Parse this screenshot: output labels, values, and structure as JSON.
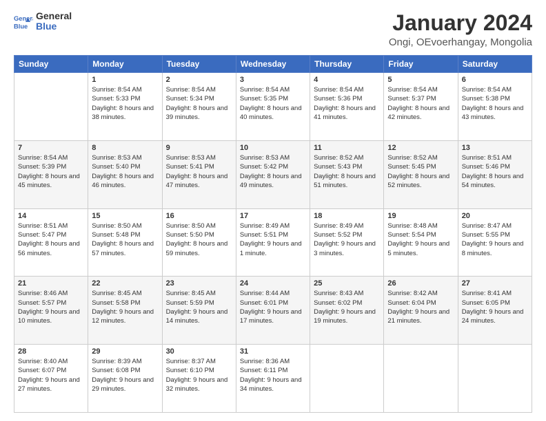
{
  "logo": {
    "text_general": "General",
    "text_blue": "Blue"
  },
  "header": {
    "title": "January 2024",
    "subtitle": "Ongi, OEvoerhangay, Mongolia"
  },
  "weekdays": [
    "Sunday",
    "Monday",
    "Tuesday",
    "Wednesday",
    "Thursday",
    "Friday",
    "Saturday"
  ],
  "weeks": [
    [
      {
        "day": "",
        "sunrise": "",
        "sunset": "",
        "daylight": ""
      },
      {
        "day": "1",
        "sunrise": "Sunrise: 8:54 AM",
        "sunset": "Sunset: 5:33 PM",
        "daylight": "Daylight: 8 hours and 38 minutes."
      },
      {
        "day": "2",
        "sunrise": "Sunrise: 8:54 AM",
        "sunset": "Sunset: 5:34 PM",
        "daylight": "Daylight: 8 hours and 39 minutes."
      },
      {
        "day": "3",
        "sunrise": "Sunrise: 8:54 AM",
        "sunset": "Sunset: 5:35 PM",
        "daylight": "Daylight: 8 hours and 40 minutes."
      },
      {
        "day": "4",
        "sunrise": "Sunrise: 8:54 AM",
        "sunset": "Sunset: 5:36 PM",
        "daylight": "Daylight: 8 hours and 41 minutes."
      },
      {
        "day": "5",
        "sunrise": "Sunrise: 8:54 AM",
        "sunset": "Sunset: 5:37 PM",
        "daylight": "Daylight: 8 hours and 42 minutes."
      },
      {
        "day": "6",
        "sunrise": "Sunrise: 8:54 AM",
        "sunset": "Sunset: 5:38 PM",
        "daylight": "Daylight: 8 hours and 43 minutes."
      }
    ],
    [
      {
        "day": "7",
        "sunrise": "Sunrise: 8:54 AM",
        "sunset": "Sunset: 5:39 PM",
        "daylight": "Daylight: 8 hours and 45 minutes."
      },
      {
        "day": "8",
        "sunrise": "Sunrise: 8:53 AM",
        "sunset": "Sunset: 5:40 PM",
        "daylight": "Daylight: 8 hours and 46 minutes."
      },
      {
        "day": "9",
        "sunrise": "Sunrise: 8:53 AM",
        "sunset": "Sunset: 5:41 PM",
        "daylight": "Daylight: 8 hours and 47 minutes."
      },
      {
        "day": "10",
        "sunrise": "Sunrise: 8:53 AM",
        "sunset": "Sunset: 5:42 PM",
        "daylight": "Daylight: 8 hours and 49 minutes."
      },
      {
        "day": "11",
        "sunrise": "Sunrise: 8:52 AM",
        "sunset": "Sunset: 5:43 PM",
        "daylight": "Daylight: 8 hours and 51 minutes."
      },
      {
        "day": "12",
        "sunrise": "Sunrise: 8:52 AM",
        "sunset": "Sunset: 5:45 PM",
        "daylight": "Daylight: 8 hours and 52 minutes."
      },
      {
        "day": "13",
        "sunrise": "Sunrise: 8:51 AM",
        "sunset": "Sunset: 5:46 PM",
        "daylight": "Daylight: 8 hours and 54 minutes."
      }
    ],
    [
      {
        "day": "14",
        "sunrise": "Sunrise: 8:51 AM",
        "sunset": "Sunset: 5:47 PM",
        "daylight": "Daylight: 8 hours and 56 minutes."
      },
      {
        "day": "15",
        "sunrise": "Sunrise: 8:50 AM",
        "sunset": "Sunset: 5:48 PM",
        "daylight": "Daylight: 8 hours and 57 minutes."
      },
      {
        "day": "16",
        "sunrise": "Sunrise: 8:50 AM",
        "sunset": "Sunset: 5:50 PM",
        "daylight": "Daylight: 8 hours and 59 minutes."
      },
      {
        "day": "17",
        "sunrise": "Sunrise: 8:49 AM",
        "sunset": "Sunset: 5:51 PM",
        "daylight": "Daylight: 9 hours and 1 minute."
      },
      {
        "day": "18",
        "sunrise": "Sunrise: 8:49 AM",
        "sunset": "Sunset: 5:52 PM",
        "daylight": "Daylight: 9 hours and 3 minutes."
      },
      {
        "day": "19",
        "sunrise": "Sunrise: 8:48 AM",
        "sunset": "Sunset: 5:54 PM",
        "daylight": "Daylight: 9 hours and 5 minutes."
      },
      {
        "day": "20",
        "sunrise": "Sunrise: 8:47 AM",
        "sunset": "Sunset: 5:55 PM",
        "daylight": "Daylight: 9 hours and 8 minutes."
      }
    ],
    [
      {
        "day": "21",
        "sunrise": "Sunrise: 8:46 AM",
        "sunset": "Sunset: 5:57 PM",
        "daylight": "Daylight: 9 hours and 10 minutes."
      },
      {
        "day": "22",
        "sunrise": "Sunrise: 8:45 AM",
        "sunset": "Sunset: 5:58 PM",
        "daylight": "Daylight: 9 hours and 12 minutes."
      },
      {
        "day": "23",
        "sunrise": "Sunrise: 8:45 AM",
        "sunset": "Sunset: 5:59 PM",
        "daylight": "Daylight: 9 hours and 14 minutes."
      },
      {
        "day": "24",
        "sunrise": "Sunrise: 8:44 AM",
        "sunset": "Sunset: 6:01 PM",
        "daylight": "Daylight: 9 hours and 17 minutes."
      },
      {
        "day": "25",
        "sunrise": "Sunrise: 8:43 AM",
        "sunset": "Sunset: 6:02 PM",
        "daylight": "Daylight: 9 hours and 19 minutes."
      },
      {
        "day": "26",
        "sunrise": "Sunrise: 8:42 AM",
        "sunset": "Sunset: 6:04 PM",
        "daylight": "Daylight: 9 hours and 21 minutes."
      },
      {
        "day": "27",
        "sunrise": "Sunrise: 8:41 AM",
        "sunset": "Sunset: 6:05 PM",
        "daylight": "Daylight: 9 hours and 24 minutes."
      }
    ],
    [
      {
        "day": "28",
        "sunrise": "Sunrise: 8:40 AM",
        "sunset": "Sunset: 6:07 PM",
        "daylight": "Daylight: 9 hours and 27 minutes."
      },
      {
        "day": "29",
        "sunrise": "Sunrise: 8:39 AM",
        "sunset": "Sunset: 6:08 PM",
        "daylight": "Daylight: 9 hours and 29 minutes."
      },
      {
        "day": "30",
        "sunrise": "Sunrise: 8:37 AM",
        "sunset": "Sunset: 6:10 PM",
        "daylight": "Daylight: 9 hours and 32 minutes."
      },
      {
        "day": "31",
        "sunrise": "Sunrise: 8:36 AM",
        "sunset": "Sunset: 6:11 PM",
        "daylight": "Daylight: 9 hours and 34 minutes."
      },
      {
        "day": "",
        "sunrise": "",
        "sunset": "",
        "daylight": ""
      },
      {
        "day": "",
        "sunrise": "",
        "sunset": "",
        "daylight": ""
      },
      {
        "day": "",
        "sunrise": "",
        "sunset": "",
        "daylight": ""
      }
    ]
  ]
}
